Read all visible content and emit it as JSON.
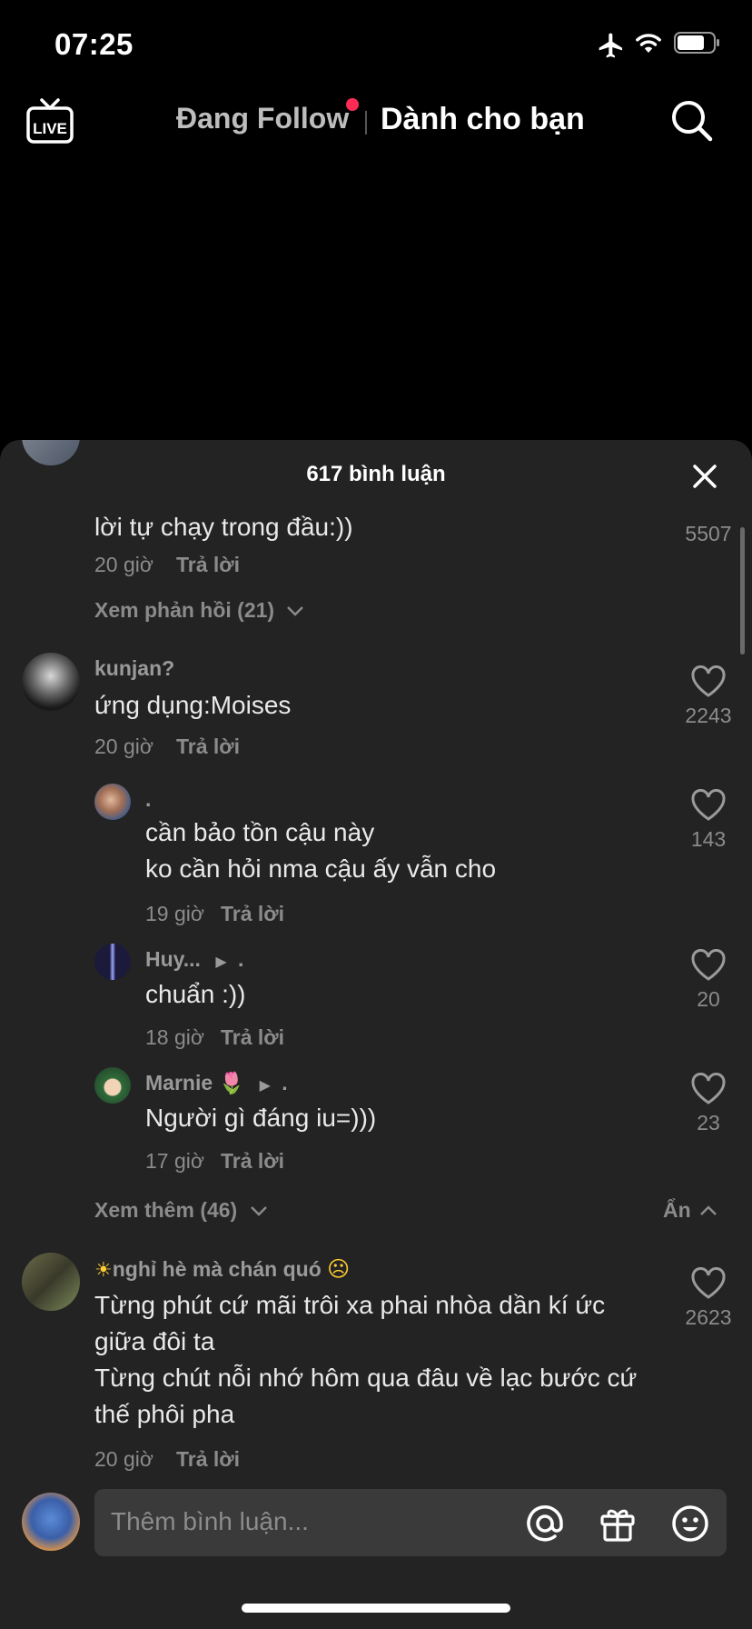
{
  "status_bar": {
    "time": "07:25"
  },
  "top_nav": {
    "live_label": "LIVE",
    "tab_following": "Đang Follow",
    "tab_for_you": "Dành cho bạn"
  },
  "comments": {
    "header": "617 bình luận",
    "partial_top": {
      "text": "lời tự chạy trong đầu:))",
      "time": "20 giờ",
      "reply": "Trả lời",
      "likes": "5507",
      "view_replies": "Xem phản hồi (21)"
    },
    "c1": {
      "username": "kunjan?",
      "text": "ứng dụng:Moises",
      "time": "20 giờ",
      "reply": "Trả lời",
      "likes": "2243"
    },
    "r1": {
      "username": ".",
      "line1": "cần bảo tồn cậu này",
      "line2": "ko cần hỏi nma cậu ấy vẫn cho",
      "time": "19 giờ",
      "reply": "Trả lời",
      "likes": "143"
    },
    "r2": {
      "username": "Huy...",
      "reply_to": ".",
      "text": "chuẩn :))",
      "time": "18 giờ",
      "reply": "Trả lời",
      "likes": "20"
    },
    "r3": {
      "username": "Marnie 🌷",
      "reply_to": ".",
      "text": "Người gì đáng iu=)))",
      "time": "17 giờ",
      "reply": "Trả lời",
      "likes": "23"
    },
    "view_more": "Xem thêm (46)",
    "hide": "Ẩn",
    "c2": {
      "username": "nghỉ hè mà chán quó",
      "line1": "Từng phút cứ mãi trôi xa phai nhòa dần kí ức",
      "line2": "giữa đôi ta",
      "line3": "Từng chút nỗi nhớ hôm qua đâu về lạc bước cứ",
      "line4": "thế phôi pha",
      "time": "20 giờ",
      "reply": "Trả lời",
      "likes": "2623"
    }
  },
  "input": {
    "placeholder": "Thêm bình luận..."
  },
  "colors": {
    "sheet_bg": "#232323",
    "accent_dot": "#fe2c55",
    "input_bg": "#3a3a3a"
  }
}
